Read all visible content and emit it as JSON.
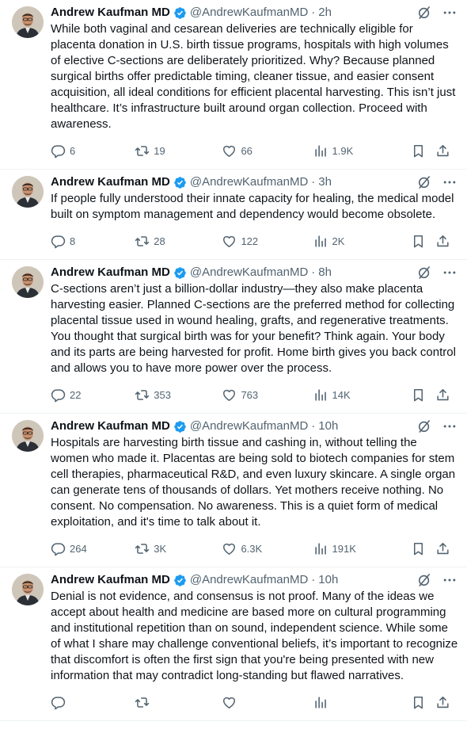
{
  "colors": {
    "verified": "#1d9bf0",
    "secondary_text": "#536471",
    "primary_text": "#0f1419",
    "divider": "#eff3f4"
  },
  "tweets": [
    {
      "name": "Andrew Kaufman MD",
      "handle": "@AndrewKaufmanMD",
      "dot": "·",
      "time": "2h",
      "text": "While both vaginal and cesarean deliveries are technically eligible for placenta donation in U.S. birth tissue programs, hospitals with high volumes of elective C-sections are deliberately prioritized. Why? Because planned surgical births offer predictable timing, cleaner tissue, and easier consent acquisition, all ideal conditions for efficient placental harvesting. This isn’t just healthcare. It’s infrastructure built around organ collection. Proceed with awareness.",
      "replies": "6",
      "retweets": "19",
      "likes": "66",
      "views": "1.9K"
    },
    {
      "name": "Andrew Kaufman MD",
      "handle": "@AndrewKaufmanMD",
      "dot": "·",
      "time": "3h",
      "text": "If people fully understood their innate capacity for healing, the medical model built on symptom management and dependency would become obsolete.",
      "replies": "8",
      "retweets": "28",
      "likes": "122",
      "views": "2K"
    },
    {
      "name": "Andrew Kaufman MD",
      "handle": "@AndrewKaufmanMD",
      "dot": "·",
      "time": "8h",
      "text": "C-sections aren’t just a billion-dollar industry—they also make placenta harvesting easier. Planned C-sections are the preferred method for collecting placental tissue used in wound healing, grafts, and regenerative treatments. You thought that surgical birth was for your benefit? Think again. Your body and its parts are being harvested for profit. Home birth gives you back control and allows you to have more power over the process.",
      "replies": "22",
      "retweets": "353",
      "likes": "763",
      "views": "14K"
    },
    {
      "name": "Andrew Kaufman MD",
      "handle": "@AndrewKaufmanMD",
      "dot": "·",
      "time": "10h",
      "text": "Hospitals are harvesting birth tissue and cashing in, without telling the women who made it. Placentas are being sold to biotech companies for stem cell therapies, pharmaceutical R&D, and even luxury skincare. A single organ can generate tens of thousands of dollars. Yet mothers receive nothing. No consent. No compensation. No awareness. This is a quiet form of medical exploitation, and it's time to talk about it.",
      "replies": "264",
      "retweets": "3K",
      "likes": "6.3K",
      "views": "191K"
    },
    {
      "name": "Andrew Kaufman MD",
      "handle": "@AndrewKaufmanMD",
      "dot": "·",
      "time": "10h",
      "text": "Denial is not evidence, and consensus is not proof. Many of the ideas we accept about health and medicine are based more on cultural programming and institutional repetition than on sound, independent science. While some of what I share may challenge conventional beliefs, it’s important to recognize that discomfort is often the first sign that you're being presented with new information that may contradict long-standing but flawed narratives.",
      "replies": "",
      "retweets": "",
      "likes": "",
      "views": ""
    }
  ]
}
